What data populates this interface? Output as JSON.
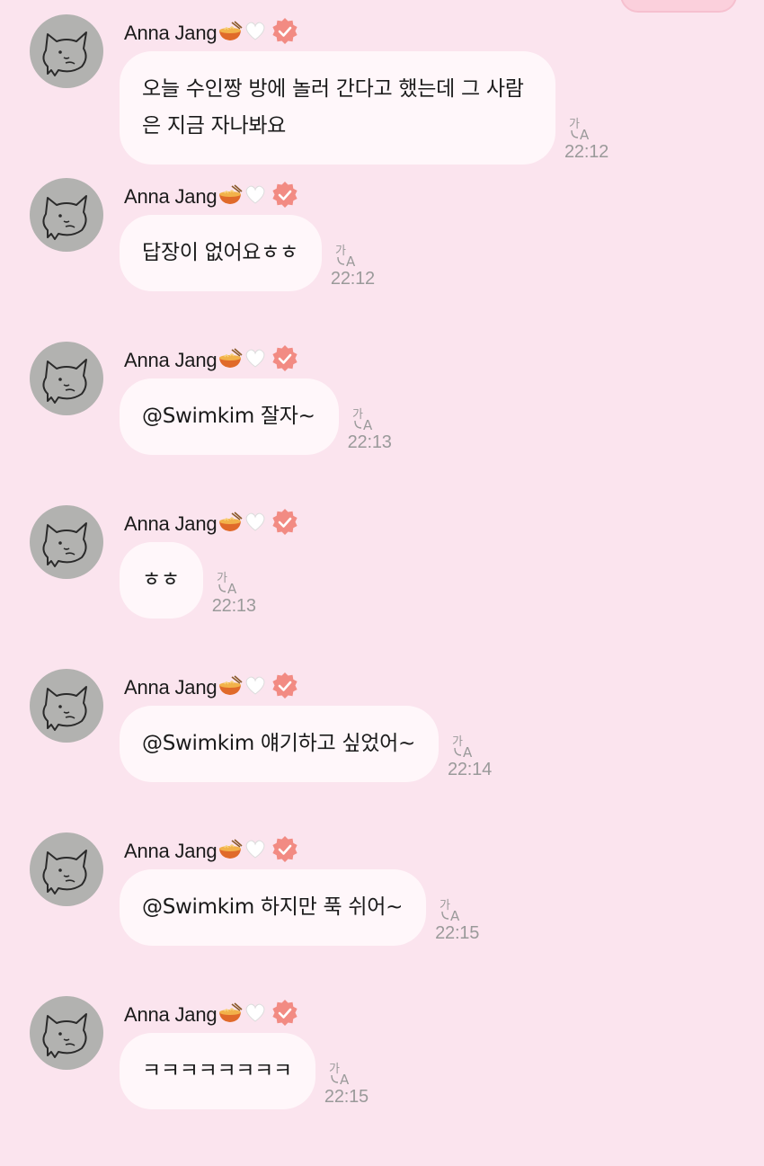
{
  "colors": {
    "background": "#fbe4ee",
    "bubble": "#fff7fa",
    "verified_badge": "#f28b83",
    "time_text": "#9a9a9a",
    "avatar": "#b2b2b0"
  },
  "icons": {
    "sender_emoji": "ramen-bowl-emoji",
    "sender_heart": "white-heart-emoji",
    "badge": "verified-badge-icon",
    "translate": "translate-icon",
    "avatar": "cat-doodle-avatar"
  },
  "messages": [
    {
      "sender": "Anna Jang",
      "text": "오늘 수인짱 방에 놀러 간다고 했는데 그 사람은 지금 자나봐요",
      "time": "22:12"
    },
    {
      "sender": "Anna Jang",
      "text": "답장이 없어요ㅎㅎ",
      "time": "22:12"
    },
    {
      "sender": "Anna Jang",
      "text": "@Swimkim 잘자~",
      "time": "22:13"
    },
    {
      "sender": "Anna Jang",
      "text": "ㅎㅎ",
      "time": "22:13"
    },
    {
      "sender": "Anna Jang",
      "text": "@Swimkim 얘기하고 싶었어~",
      "time": "22:14"
    },
    {
      "sender": "Anna Jang",
      "text": "@Swimkim 하지만 푹 쉬어~",
      "time": "22:15"
    },
    {
      "sender": "Anna Jang",
      "text": "ㅋㅋㅋㅋㅋㅋㅋㅋ",
      "time": "22:15"
    }
  ]
}
